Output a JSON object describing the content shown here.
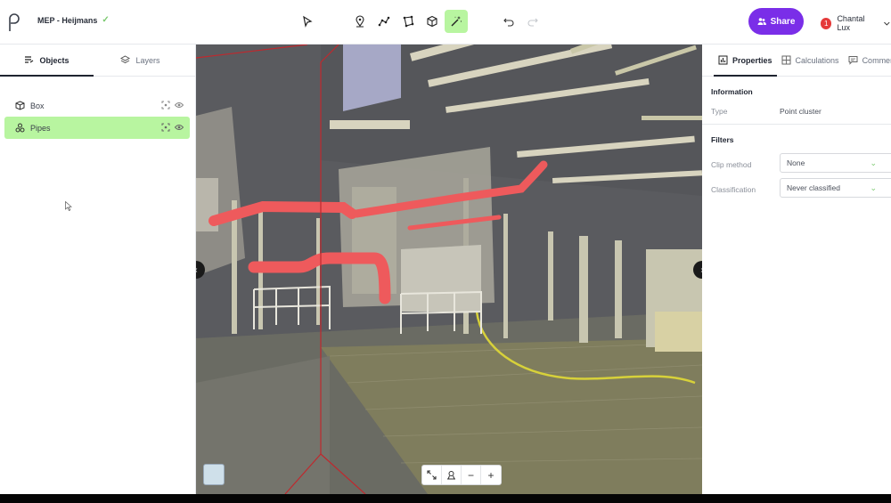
{
  "app": {
    "project_name": "MEP - Heijmans",
    "brand_color": "#7a2ee8",
    "highlight_color": "#b8f5a0"
  },
  "toolbar": {
    "tools": [
      "select-icon",
      "pin-icon",
      "polyline-icon",
      "polygon-icon",
      "box-icon",
      "magic-wand-icon"
    ],
    "active_tool": "magic-wand-icon",
    "history": [
      "undo-icon",
      "redo-icon"
    ]
  },
  "header": {
    "share_label": "Share",
    "notification_count": "1",
    "user_name": "Chantal Lux"
  },
  "left_panel": {
    "tabs": [
      {
        "label": "Objects",
        "active": true
      },
      {
        "label": "Layers",
        "active": false
      }
    ],
    "objects": [
      {
        "label": "Box",
        "selected": false
      },
      {
        "label": "Pipes",
        "selected": true
      }
    ]
  },
  "viewport": {
    "zoom_controls": [
      "expand-icon",
      "recenter-icon",
      "−",
      "+"
    ]
  },
  "right_panel": {
    "tabs": [
      {
        "label": "Properties",
        "active": true
      },
      {
        "label": "Calculations",
        "active": false
      },
      {
        "label": "Comment",
        "active": false
      }
    ],
    "information_title": "Information",
    "type_label": "Type",
    "type_value": "Point cluster",
    "filters_title": "Filters",
    "clip_method_label": "Clip method",
    "clip_method_value": "None",
    "classification_label": "Classification",
    "classification_value": "Never classified"
  }
}
